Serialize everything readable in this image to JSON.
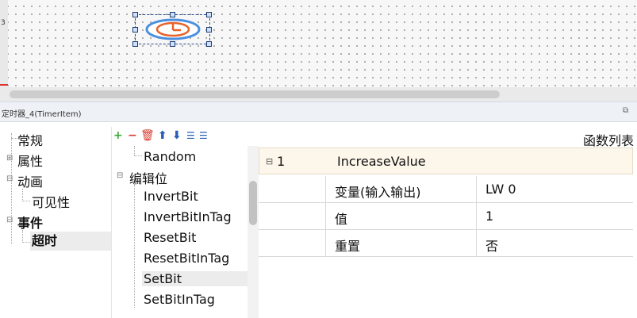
{
  "canvas": {
    "ruler_label": "3",
    "timer_icon": "timer-clock-icon"
  },
  "panel": {
    "title": "定时器_4(TimerItem)",
    "pin_icon": "pin-icon"
  },
  "tree": {
    "items": [
      {
        "label": "常规"
      },
      {
        "label": "属性"
      },
      {
        "label": "动画"
      },
      {
        "label": "可见性"
      },
      {
        "label": "事件"
      },
      {
        "label": "超时"
      }
    ]
  },
  "toolbar": {
    "icons": [
      "add-icon",
      "remove-icon",
      "delete-icon",
      "move-up-icon",
      "move-down-icon",
      "indent-icon",
      "outdent-icon"
    ]
  },
  "functions": {
    "items": [
      {
        "label": "Random"
      },
      {
        "label": "编辑位"
      },
      {
        "label": "InvertBit"
      },
      {
        "label": "InvertBitInTag"
      },
      {
        "label": "ResetBit"
      },
      {
        "label": "ResetBitInTag"
      },
      {
        "label": "SetBit"
      },
      {
        "label": "SetBitInTag"
      }
    ]
  },
  "function_table": {
    "header": "函数列表",
    "index": "1",
    "function_name": "IncreaseValue",
    "rows": [
      {
        "param": "变量(输入输出)",
        "value": "LW 0"
      },
      {
        "param": "值",
        "value": "1"
      },
      {
        "param": "重置",
        "value": "否"
      }
    ]
  },
  "colors": {
    "accent_add": "#3aa83a",
    "accent_delete": "#d9362b",
    "toolbar_blue": "#2b5fb3",
    "timer_orange": "#e8622a",
    "timer_blue": "#4b8fe0"
  }
}
